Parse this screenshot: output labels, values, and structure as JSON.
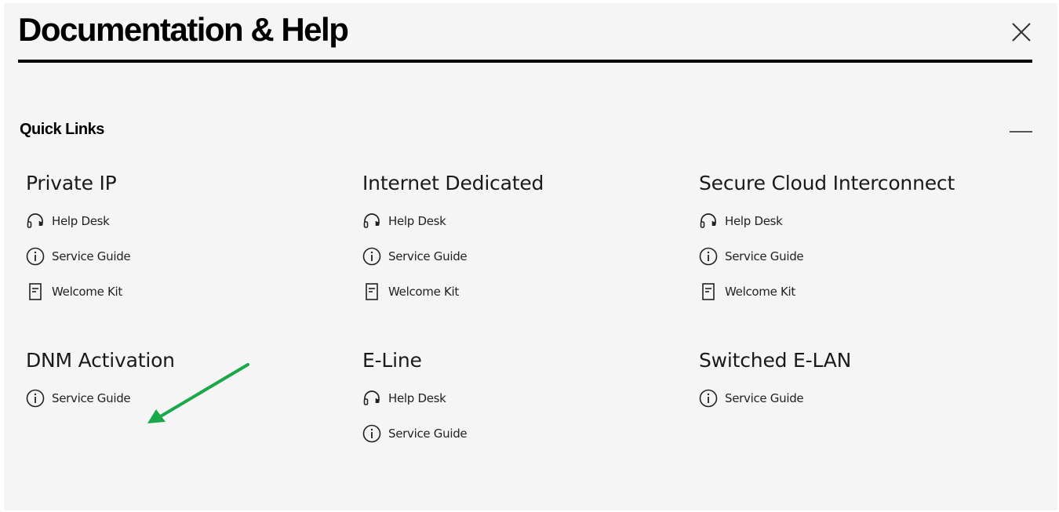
{
  "dialog": {
    "title": "Documentation & Help",
    "close_icon": "close-icon"
  },
  "quick_links": {
    "label": "Quick Links",
    "collapse_icon": "minus-icon",
    "sections": [
      {
        "title": "Private IP",
        "links": [
          {
            "label": "Help Desk",
            "icon": "headset-icon"
          },
          {
            "label": "Service Guide",
            "icon": "info-icon"
          },
          {
            "label": "Welcome Kit",
            "icon": "document-icon"
          }
        ]
      },
      {
        "title": "Internet Dedicated",
        "links": [
          {
            "label": "Help Desk",
            "icon": "headset-icon"
          },
          {
            "label": "Service Guide",
            "icon": "info-icon"
          },
          {
            "label": "Welcome Kit",
            "icon": "document-icon"
          }
        ]
      },
      {
        "title": "Secure Cloud Interconnect",
        "links": [
          {
            "label": "Help Desk",
            "icon": "headset-icon"
          },
          {
            "label": "Service Guide",
            "icon": "info-icon"
          },
          {
            "label": "Welcome Kit",
            "icon": "document-icon"
          }
        ]
      },
      {
        "title": "DNM Activation",
        "links": [
          {
            "label": "Service Guide",
            "icon": "info-icon"
          }
        ]
      },
      {
        "title": "E-Line",
        "links": [
          {
            "label": "Help Desk",
            "icon": "headset-icon"
          },
          {
            "label": "Service Guide",
            "icon": "info-icon"
          }
        ]
      },
      {
        "title": "Switched E-LAN",
        "links": [
          {
            "label": "Service Guide",
            "icon": "info-icon"
          }
        ]
      }
    ]
  },
  "annotation": {
    "arrow_icon": "arrow-icon",
    "color": "#1aa84a"
  }
}
